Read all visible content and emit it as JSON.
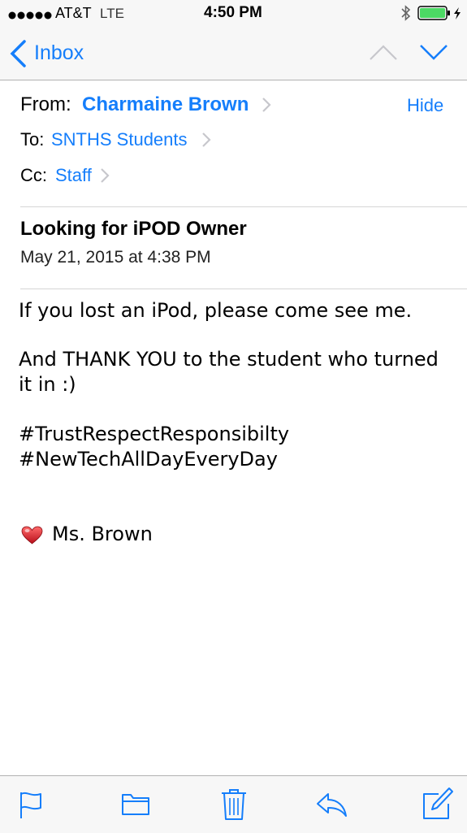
{
  "status": {
    "carrier": "AT&T",
    "network": "LTE",
    "time": "4:50 PM"
  },
  "nav": {
    "back_label": "Inbox"
  },
  "header": {
    "from_label": "From:",
    "from_name": "Charmaine Brown",
    "hide_label": "Hide",
    "to_label": "To:",
    "to_name": "SNTHS Students",
    "cc_label": "Cc:",
    "cc_name": "Staff"
  },
  "message": {
    "subject": "Looking for iPOD Owner",
    "date": "May 21, 2015 at 4:38 PM",
    "lines": [
      "If you lost an iPod, please come see me.",
      "And THANK YOU to the student who turned",
      "it in :)",
      "#TrustRespectResponsibilty",
      "#NewTechAllDayEveryDay",
      "Ms. Brown"
    ]
  },
  "toolbar_icons": [
    "flag-icon",
    "folder-icon",
    "trash-icon",
    "reply-icon",
    "compose-icon"
  ],
  "colors": {
    "accent": "#157efb",
    "battery": "#4cd964",
    "chevron": "#c7c7cc"
  }
}
